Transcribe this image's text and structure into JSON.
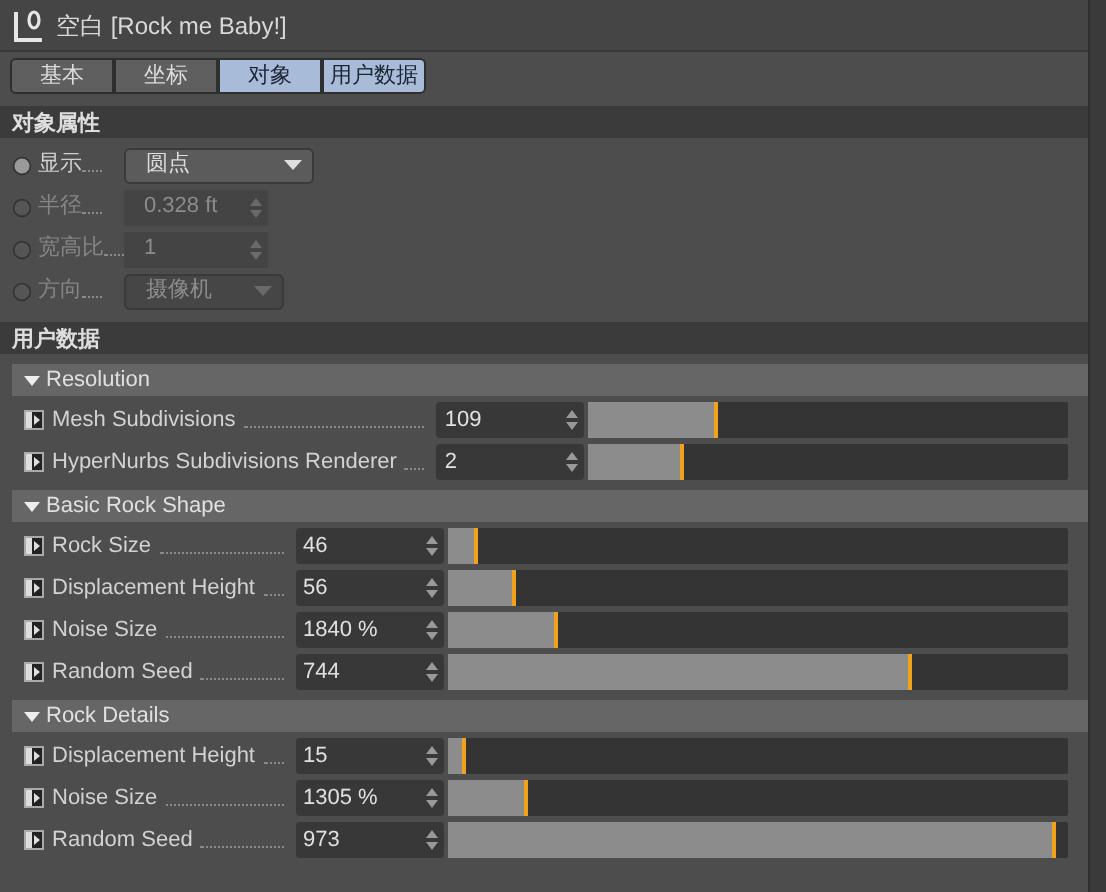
{
  "panel": {
    "title": "空白 [Rock me Baby!]"
  },
  "tabs": [
    {
      "label": "基本",
      "selected": false
    },
    {
      "label": "坐标",
      "selected": false
    },
    {
      "label": "对象",
      "selected": true
    },
    {
      "label": "用户数据",
      "selected": true
    }
  ],
  "object_properties": {
    "title": "对象属性",
    "rows": [
      {
        "kind": "dropdown",
        "label": "显示",
        "value": "圆点",
        "disabled": false
      },
      {
        "kind": "number",
        "label": "半径",
        "value": "0.328 ft",
        "disabled": true
      },
      {
        "kind": "number",
        "label": "宽高比",
        "value": "1",
        "disabled": true
      },
      {
        "kind": "dropdown",
        "label": "方向",
        "value": "摄像机",
        "disabled": true
      }
    ]
  },
  "user_data": {
    "title": "用户数据",
    "groups": [
      {
        "title": "Resolution",
        "expanded": true,
        "rows": [
          {
            "label": "Mesh Subdivisions",
            "value": "109",
            "level": 0.27
          },
          {
            "label": "HyperNurbs Subdivisions Renderer",
            "value": "2",
            "level": 0.2
          }
        ]
      },
      {
        "title": "Basic Rock Shape",
        "expanded": true,
        "rows": [
          {
            "label": "Rock Size",
            "value": "46",
            "level": 0.05
          },
          {
            "label": "Displacement Height",
            "value": "56",
            "level": 0.11
          },
          {
            "label": "Noise Size",
            "value": "1840 %",
            "level": 0.18
          },
          {
            "label": "Random Seed",
            "value": "744",
            "level": 0.75
          }
        ]
      },
      {
        "title": "Rock Details",
        "expanded": true,
        "rows": [
          {
            "label": "Displacement Height",
            "value": "15",
            "level": 0.03
          },
          {
            "label": "Noise Size",
            "value": "1305 %",
            "level": 0.13
          },
          {
            "label": "Random Seed",
            "value": "973",
            "level": 0.98
          }
        ]
      }
    ]
  }
}
